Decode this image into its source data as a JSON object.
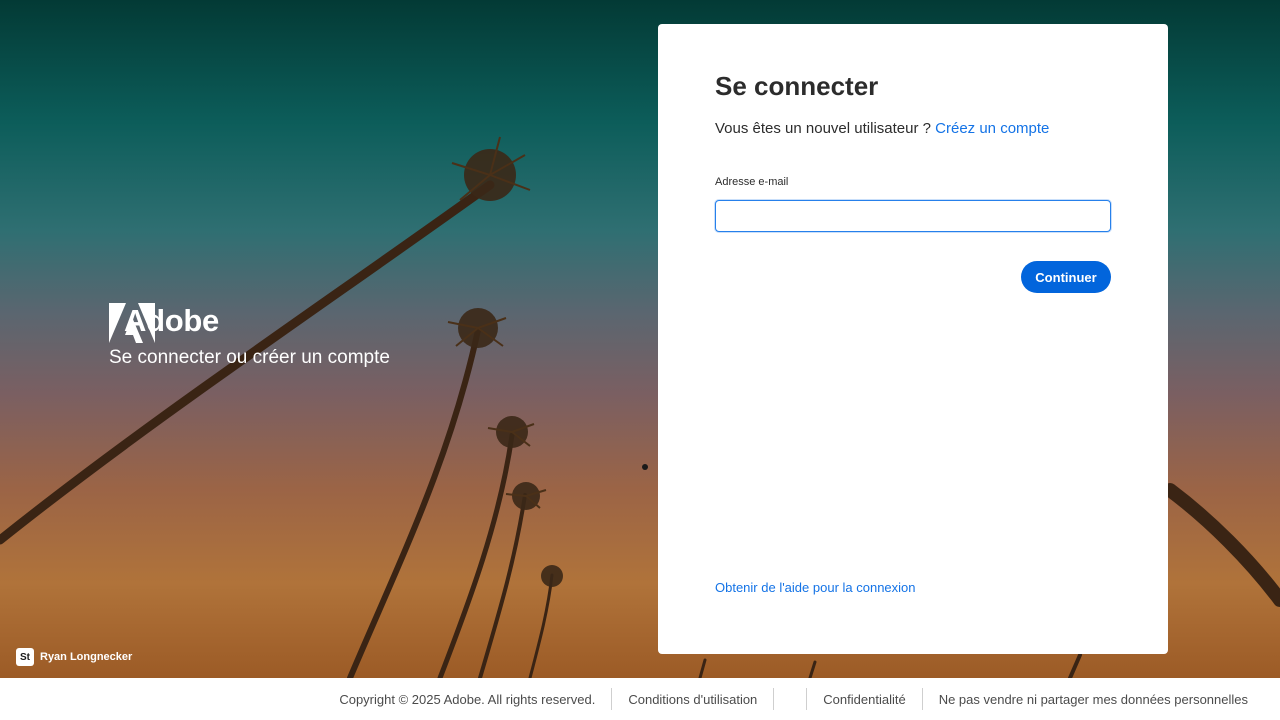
{
  "brand": {
    "name": "Adobe",
    "subtitle": "Se connecter ou créer un compte"
  },
  "credit": {
    "badge": "St",
    "photographer": "Ryan Longnecker"
  },
  "signin": {
    "title": "Se connecter",
    "new_user_text": "Vous êtes un nouvel utilisateur ?",
    "create_account_link": "Créez un compte",
    "email_label": "Adresse e-mail",
    "email_value": "",
    "continue_label": "Continuer",
    "help_link": "Obtenir de l'aide pour la connexion"
  },
  "footer": {
    "copyright": "Copyright © 2025 Adobe. All rights reserved.",
    "terms": "Conditions d'utilisation",
    "privacy": "Confidentialité",
    "do_not_sell": "Ne pas vendre ni partager mes données personnelles"
  },
  "colors": {
    "accent": "#0265dc",
    "link": "#1473e6"
  }
}
